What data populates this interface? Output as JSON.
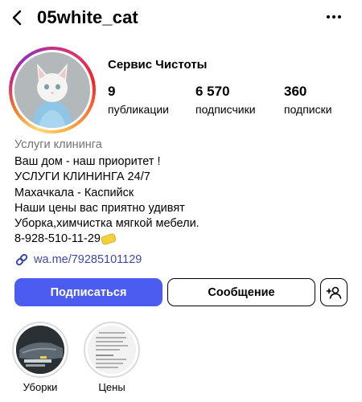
{
  "header": {
    "username": "05white_cat",
    "back_icon": "chevron-left-icon",
    "more_icon": "more-horizontal-icon"
  },
  "profile": {
    "display_name": "Сервис Чистоты",
    "stats": {
      "posts": {
        "value": "9",
        "label": "публикации"
      },
      "followers": {
        "value": "6 570",
        "label": "подписчики"
      },
      "following": {
        "value": "360",
        "label": "подписки"
      }
    },
    "category": "Услуги клининга",
    "bio_lines": [
      "Ваш дом - наш приоритет !",
      "УСЛУГИ КЛИНИНГА 24/7",
      "Махачкала - Каспийск",
      "Наши цены вас приятно удивят",
      "Уборка,химчистка мягкой мебели.",
      "8-928-510-11-29"
    ],
    "link": "wa.me/79285101129"
  },
  "actions": {
    "follow_label": "Подписаться",
    "message_label": "Сообщение",
    "add_user_icon": "person-add-icon"
  },
  "highlights": [
    {
      "label": "Уборки"
    },
    {
      "label": "Цены"
    }
  ],
  "colors": {
    "accent": "#4d5cf0",
    "link": "#3b4aa8",
    "muted": "#737373"
  }
}
